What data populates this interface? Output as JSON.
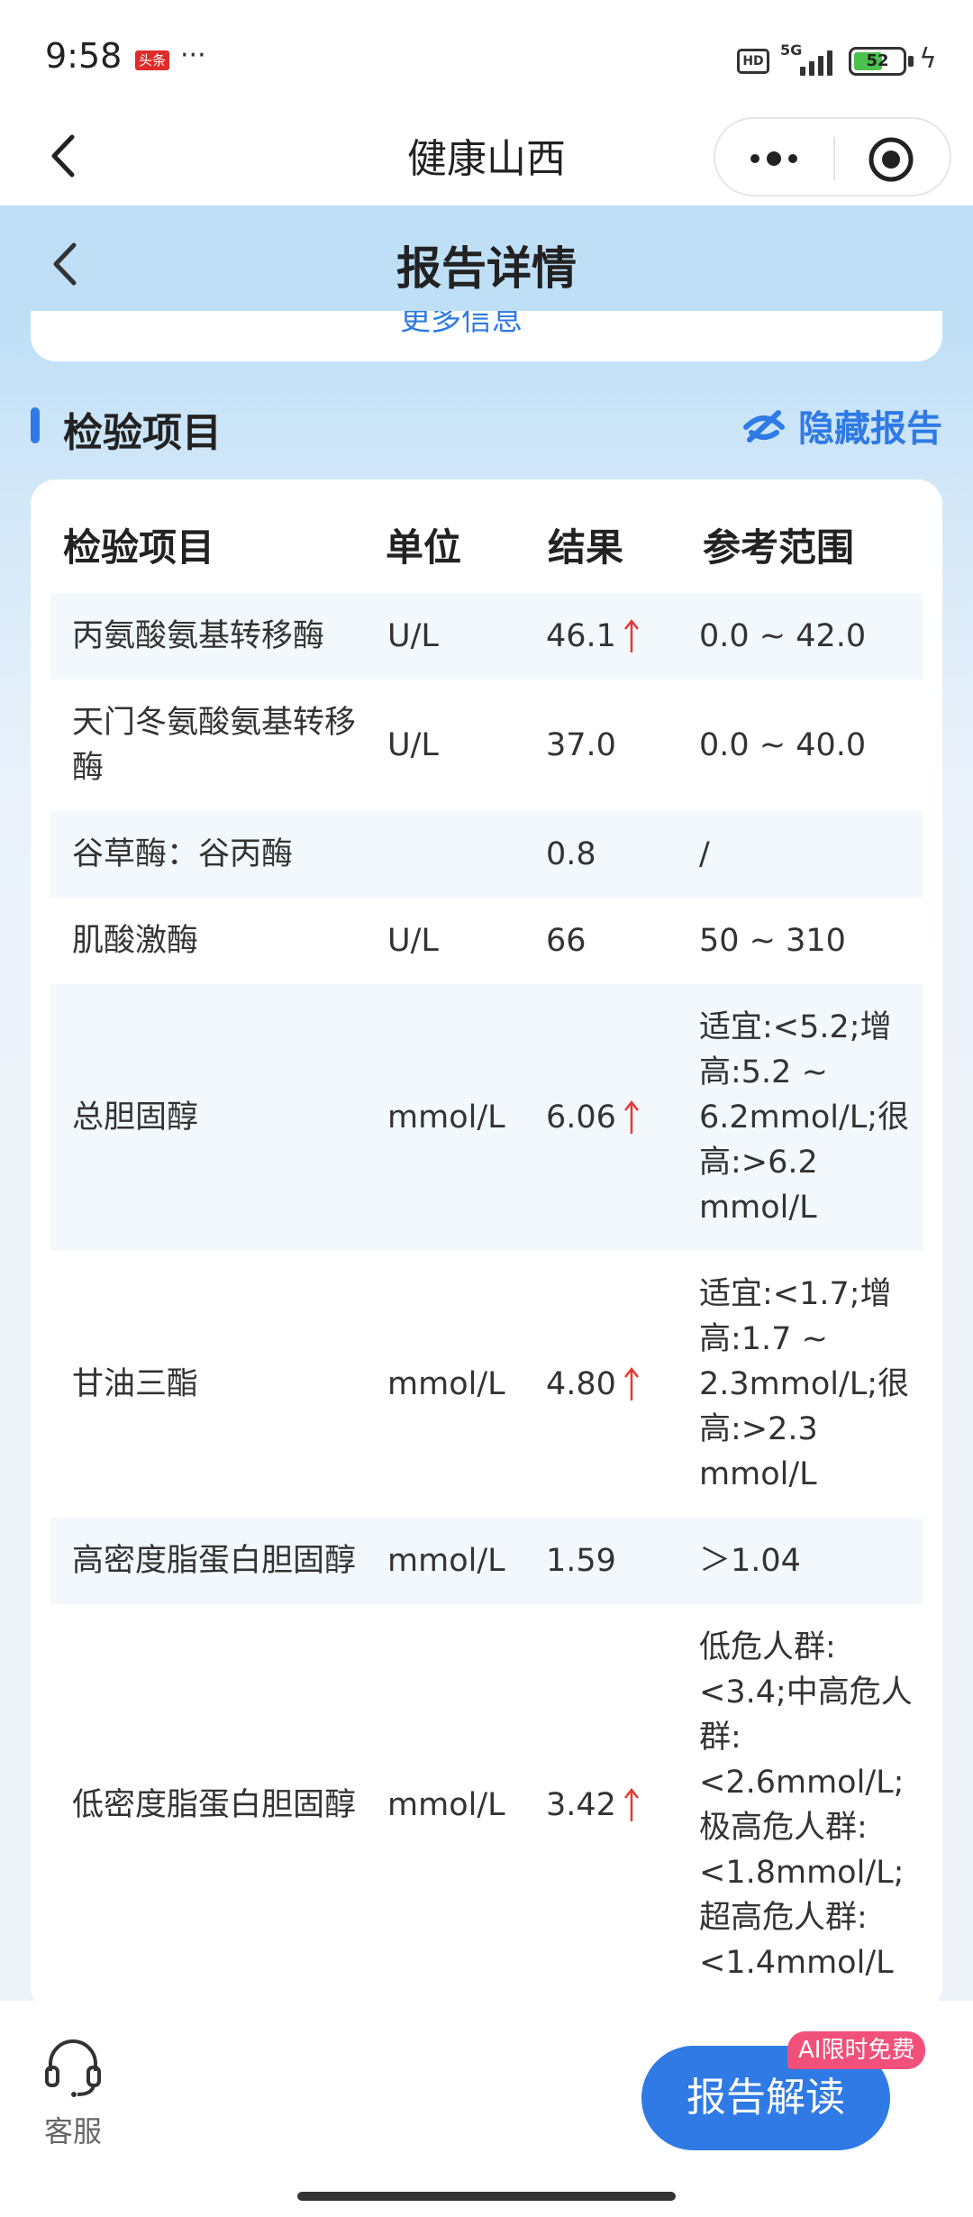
{
  "status": {
    "time": "9:58",
    "news_badge": "头条",
    "more": "···",
    "hd": "HD",
    "network": "5G",
    "battery": "52"
  },
  "mp_nav": {
    "title": "健康山西",
    "back_icon": "chevron-left-icon",
    "more_icon": "more-dots-icon",
    "close_icon": "target-icon"
  },
  "header": {
    "title": "报告详情"
  },
  "prev_card": {
    "text": "更多信息"
  },
  "section": {
    "title": "检验项目",
    "hide_label": "隐藏报告"
  },
  "table": {
    "headers": [
      "检验项目",
      "单位",
      "结果",
      "参考范围"
    ],
    "rows": [
      {
        "name": "丙氨酸氨基转移酶",
        "unit": "U/L",
        "result": "46.1",
        "range": "0.0 ~ 42.0",
        "high": true
      },
      {
        "name": "天门冬氨酸氨基转移酶",
        "unit": "U/L",
        "result": "37.0",
        "range": "0.0 ~ 40.0",
        "high": false
      },
      {
        "name": "谷草酶：谷丙酶",
        "unit": "",
        "result": "0.8",
        "range": "/",
        "high": false
      },
      {
        "name": "肌酸激酶",
        "unit": "U/L",
        "result": "66",
        "range": "50 ~ 310",
        "high": false
      },
      {
        "name": "总胆固醇",
        "unit": "mmol/L",
        "result": "6.06",
        "range": "适宜:<5.2;增高:5.2 ~ 6.2mmol/L;很高:>6.2 mmol/L",
        "high": true
      },
      {
        "name": "甘油三酯",
        "unit": "mmol/L",
        "result": "4.80",
        "range": "适宜:<1.7;增高:1.7 ~ 2.3mmol/L;很高:>2.3 mmol/L",
        "high": true
      },
      {
        "name": "高密度脂蛋白胆固醇",
        "unit": "mmol/L",
        "result": "1.59",
        "range": "＞1.04",
        "high": false
      },
      {
        "name": "低密度脂蛋白胆固醇",
        "unit": "mmol/L",
        "result": "3.42",
        "range": "低危人群:<3.4;中高危人群:<2.6mmol/L;极高危人群:<1.8mmol/L;超高危人群:<1.4mmol/L",
        "high": true
      }
    ]
  },
  "bottom": {
    "service_label": "客服",
    "interpret_label": "报告解读",
    "ai_badge": "AI限时免费"
  },
  "colors": {
    "accent": "#2f7ae5",
    "header_bg": "#bfdff7",
    "high_arrow": "#e53935",
    "badge": "#f0507a"
  }
}
